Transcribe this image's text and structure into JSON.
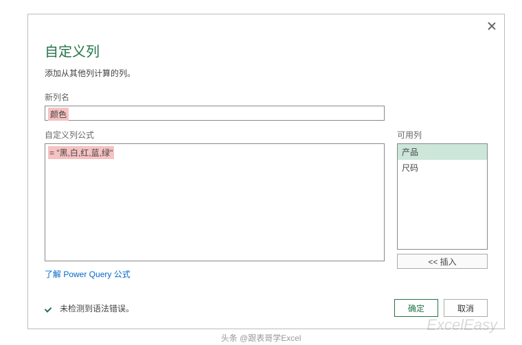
{
  "dialog": {
    "title": "自定义列",
    "subtitle": "添加从其他列计算的列。",
    "newColNameLabel": "新列名",
    "newColNameValue": "颜色",
    "formulaLabel": "自定义列公式",
    "formulaValue": "= \"黑,白,红,蓝,绿\"",
    "availLabel": "可用列",
    "availColumns": [
      "产品",
      "尺码"
    ],
    "insertBtn": "<< 插入",
    "learnLink": "了解 Power Query 公式",
    "statusText": "未检测到语法错误。",
    "okBtn": "确定",
    "cancelBtn": "取消"
  },
  "attribution": "头条 @跟表哥学Excel",
  "watermark": "ExcelEasy"
}
